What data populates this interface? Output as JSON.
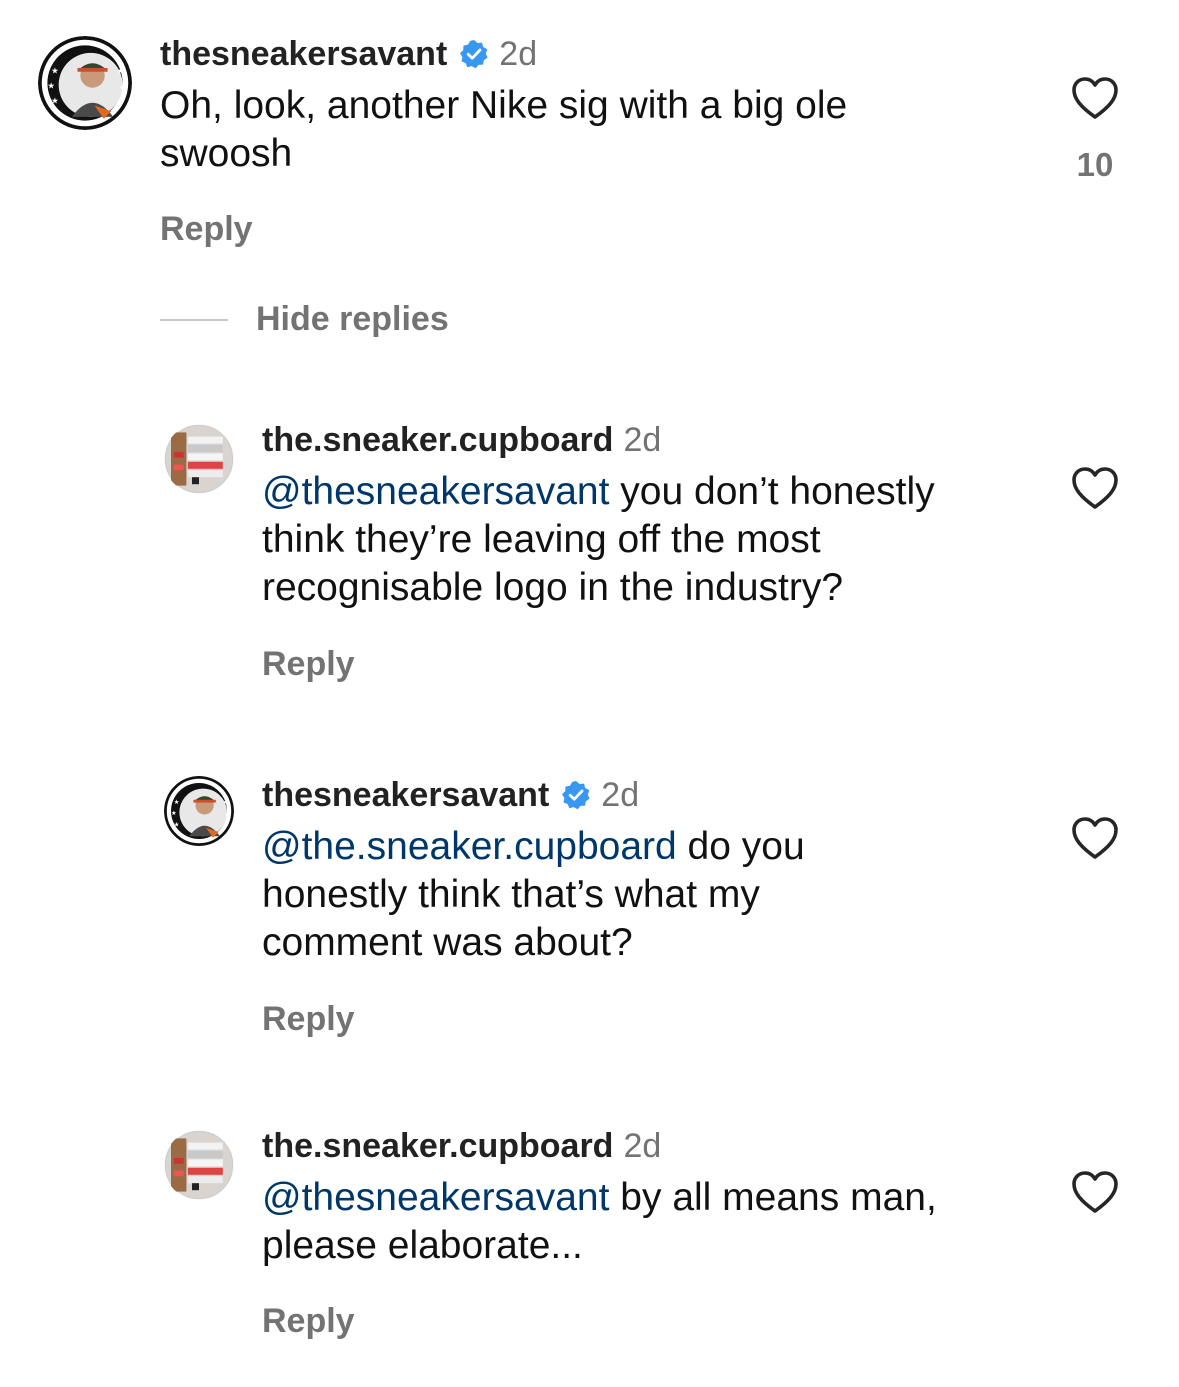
{
  "colors": {
    "text": "#111111",
    "muted": "#737373",
    "mention": "#00376b",
    "verified": "#3897f0"
  },
  "comments": [
    {
      "username": "thesneakersavant",
      "verified": true,
      "time": "2d",
      "text_lines": [
        "Oh, look, another Nike sig with a big ole",
        "swoosh"
      ],
      "mention": "",
      "reply_label": "Reply",
      "like_icon": "heart-outline-icon",
      "like_count": "10"
    }
  ],
  "thread": {
    "hide_replies_label": "Hide replies"
  },
  "replies": [
    {
      "username": "the.sneaker.cupboard",
      "verified": false,
      "time": "2d",
      "mention": "@thesneakersavant",
      "text_first": " you don’t honestly",
      "text_rest": "think they’re leaving off the most\nrecognisable logo in the industry?",
      "reply_label": "Reply",
      "like_icon": "heart-outline-icon"
    },
    {
      "username": "thesneakersavant",
      "verified": true,
      "time": "2d",
      "mention": "@the.sneaker.cupboard",
      "text_first": " do you",
      "text_rest": "honestly think that’s what my\ncomment was about?",
      "reply_label": "Reply",
      "like_icon": "heart-outline-icon"
    },
    {
      "username": "the.sneaker.cupboard",
      "verified": false,
      "time": "2d",
      "mention": "@thesneakersavant",
      "text_first": " by all means man,",
      "text_rest": "please elaborate...",
      "reply_label": "Reply",
      "like_icon": "heart-outline-icon"
    }
  ]
}
